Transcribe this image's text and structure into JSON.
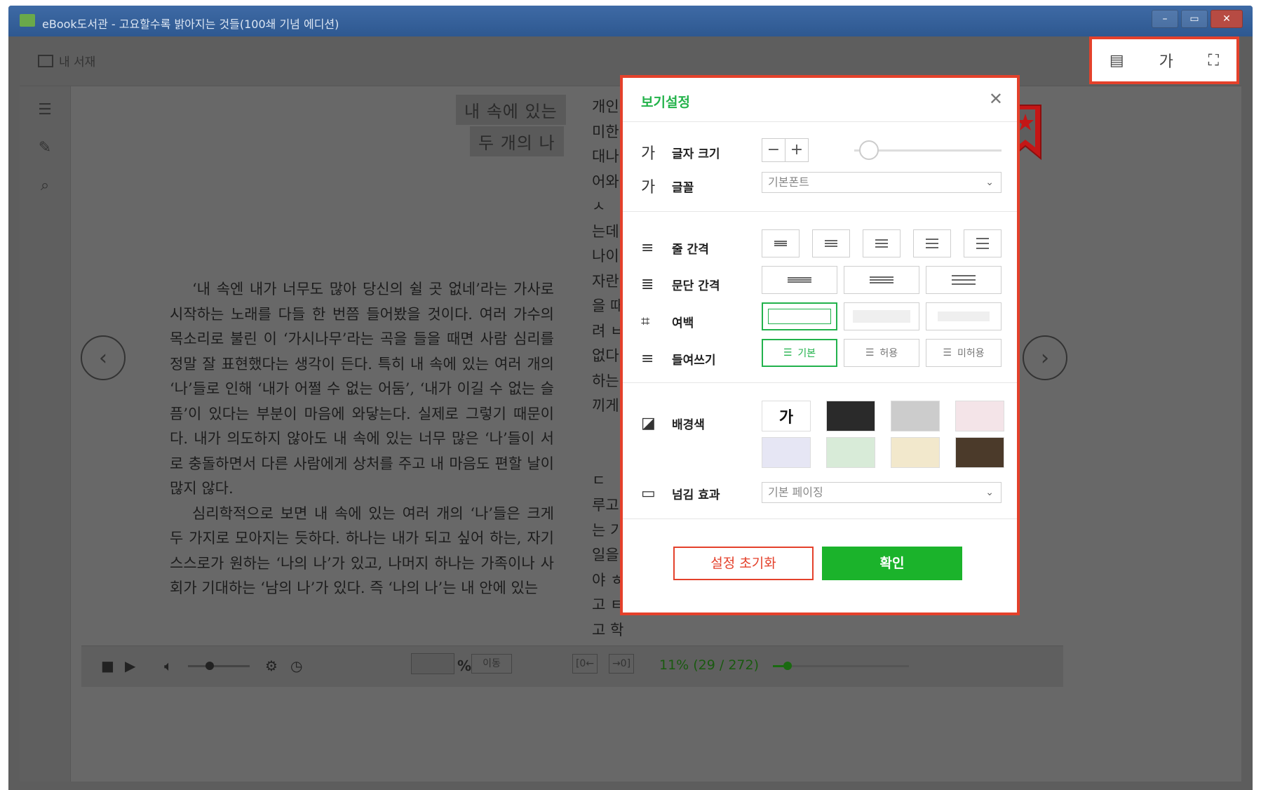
{
  "window": {
    "title": "eBook도서관 - 고요할수록 밝아지는 것들(100쇄 기념 에디션)",
    "controls": [
      "–",
      "▭",
      "✕"
    ]
  },
  "topbar": {
    "library_label": "내 서재",
    "icons": [
      "toc-page-icon",
      "font-size-icon",
      "fullscreen-icon"
    ],
    "font_icon_label": "가"
  },
  "leftbar": {
    "icons": [
      "list-icon",
      "memo-icon",
      "search-icon"
    ]
  },
  "book": {
    "heading_line1": "내 속에 있는",
    "heading_line2": "두 개의 나",
    "paragraphs": [
      "‘내 속엔 내가 너무도 많아 당신의 쉴 곳 없네’라는 가사로 시작하는 노래를 다들 한 번쯤 들어봤을 것이다. 여러 가수의 목소리로 불린 이 ‘가시나무’라는 곡을 들을 때면 사람 심리를 정말 잘 표현했다는 생각이 든다. 특히 내 속에 있는 여러 개의 ‘나’들로 인해 ‘내가 어쩔 수 없는 어둠’, ‘내가 이길 수 없는 슬픔’이 있다는 부분이 마음에 와닿는다. 실제로 그렇기 때문이다. 내가 의도하지 않아도 내 속에 있는 너무 많은 ‘나’들이 서로 충돌하면서 다른 사람에게 상처를 주고 내 마음도 편할 날이 많지 않다.",
      "심리학적으로 보면 내 속에 있는 여러 개의 ‘나’들은 크게 두 가지로 모아지는 듯하다. 하나는 내가 되고 싶어 하는, 자기 스스로가 원하는 ‘나의 나’가 있고, 나머지 하나는 가족이나 사회가 기대하는 ‘남의 나’가 있다. 즉 ‘나의 나’는 내 안에 있는"
    ],
    "right_column_fragments": [
      "개인",
      "미한",
      "대나",
      "어와",
      "ㅅ",
      "는데",
      "나이",
      "자란",
      "을 때",
      "려 ㅂ",
      "없다",
      "하는",
      "끼게",
      "",
      "",
      "ㄷ",
      "루고",
      "는 기",
      "일을",
      "야 ㅎ",
      "고 ㅌ",
      "고 학"
    ]
  },
  "nav": {
    "prev": "‹",
    "next": "›"
  },
  "bottombar": {
    "percent_sign": "%",
    "move_label": "이동",
    "prev_chapter": "[0←",
    "next_chapter": "→0]",
    "progress_text": "11% (29 / 272)",
    "volume_level": 0.35,
    "progress_fraction": 0.11
  },
  "settings": {
    "title": "보기설정",
    "close": "✕",
    "font_size_label": "글자 크기",
    "font_size_icon": "가",
    "font_size_minus": "−",
    "font_size_plus": "+",
    "font_size_level": 0.1,
    "font_label": "글꼴",
    "font_icon": "가",
    "font_value": "기본폰트",
    "line_spacing_label": "줄 간격",
    "paragraph_spacing_label": "문단 간격",
    "margin_label": "여백",
    "indent_label": "들여쓰기",
    "indent_options": [
      "기본",
      "허용",
      "미허용"
    ],
    "bg_color_label": "배경색",
    "bg_first_swatch_text": "가",
    "bg_colors": [
      "#ffffff",
      "#2a2a2a",
      "#cccccc",
      "#f4e4e8",
      "#e6e6f4",
      "#d8ebd8",
      "#f2e8cc",
      "#4b3a2a"
    ],
    "page_effect_label": "넘김 효과",
    "page_effect_value": "기본 페이징",
    "reset_label": "설정 초기화",
    "ok_label": "확인",
    "accent": "#22b24c",
    "highlight": "#e4412b"
  }
}
